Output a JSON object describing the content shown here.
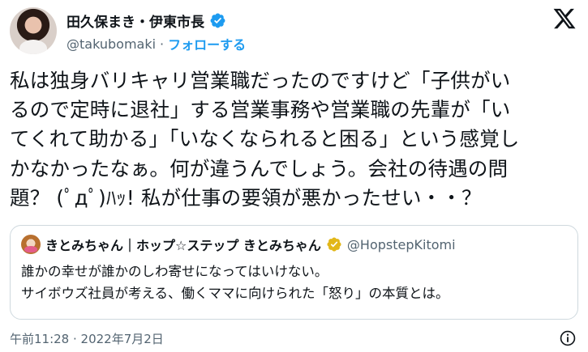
{
  "author": {
    "name": "田久保まき・伊東市長",
    "handle": "@takubomaki",
    "separator": "·",
    "follow_label": "フォローする"
  },
  "tweet": {
    "lines": [
      "私は独身バリキャリ営業職だったのですけど「子供がい",
      "るので定時に退社」する営業事務や営業職の先輩が「い",
      "てくれて助かる」「いなくなられると困る」という感覚し",
      "かなかったなぁ。何が違うんでしょう。会社の待遇の問",
      "題？ (ﾟдﾟ)ﾊｯ! 私が仕事の要領が悪かったせい・・？"
    ]
  },
  "quote": {
    "name": "きとみちゃん｜ホップ☆ステップ きとみちゃん",
    "handle": "@HopstepKitomi",
    "lines": [
      "誰かの幸せが誰かのしわ寄せになってはいけない。",
      "サイボウズ社員が考える、働くママに向けられた「怒り」の本質とは。"
    ]
  },
  "footer": {
    "timestamp": "午前11:28 · 2022年7月2日"
  },
  "colors": {
    "accent": "#1d9bf0",
    "secondary_text": "#536471",
    "border": "#cfd9de",
    "gold_badge": "#e2b719"
  },
  "icons": {
    "verified": "verified-badge-icon",
    "brand": "x-logo-icon",
    "info": "info-icon"
  }
}
